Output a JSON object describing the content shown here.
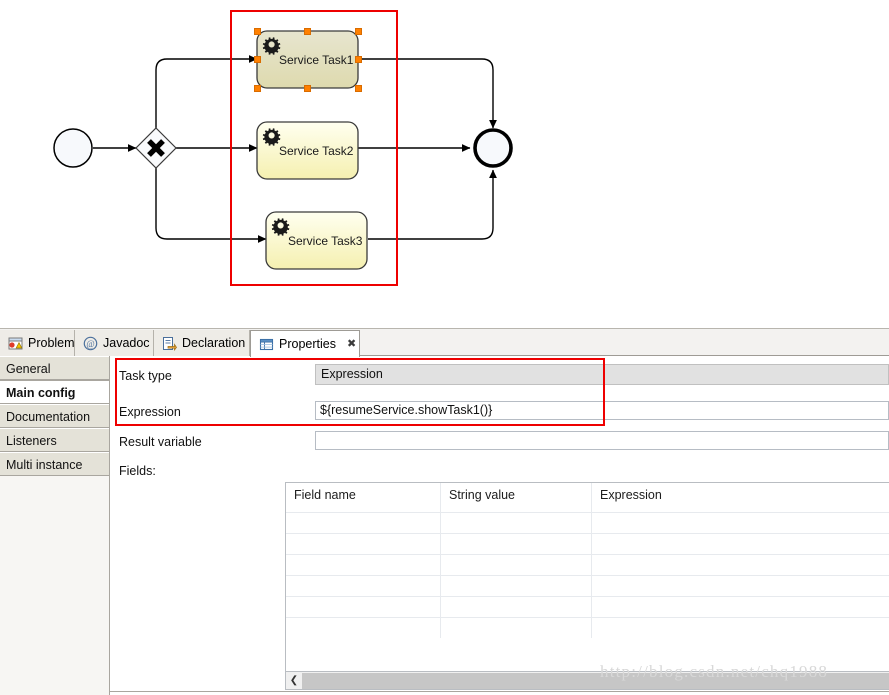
{
  "diagram": {
    "nodes": [
      {
        "id": "start-event",
        "type": "start-event",
        "label": ""
      },
      {
        "id": "gateway",
        "type": "exclusive-gateway",
        "label": ""
      },
      {
        "id": "task1",
        "type": "service-task",
        "label": "Service Task1",
        "selected": true
      },
      {
        "id": "task2",
        "type": "service-task",
        "label": "Service Task2",
        "selected": false
      },
      {
        "id": "task3",
        "type": "service-task",
        "label": "Service Task3",
        "selected": false
      },
      {
        "id": "end-event",
        "type": "end-event",
        "label": ""
      }
    ],
    "task_labels": {
      "task1": "Service Task1",
      "task2": "Service Task2",
      "task3": "Service Task3"
    },
    "highlight_color": "#ee0000",
    "selection_handle_color": "#ff8000"
  },
  "tabbar": {
    "tabs": [
      {
        "label": "Problems",
        "icon": "problems-icon",
        "active": false,
        "closable": false
      },
      {
        "label": "Javadoc",
        "icon": "javadoc-icon",
        "active": false,
        "closable": false
      },
      {
        "label": "Declaration",
        "icon": "declaration-icon",
        "active": false,
        "closable": false
      },
      {
        "label": "Properties",
        "icon": "properties-icon",
        "active": true,
        "closable": true
      }
    ],
    "close_glyph": "✖"
  },
  "sidebar": {
    "items": [
      {
        "label": "General",
        "selected": false
      },
      {
        "label": "Main config",
        "selected": true
      },
      {
        "label": "Documentation",
        "selected": false
      },
      {
        "label": "Listeners",
        "selected": false
      },
      {
        "label": "Multi instance",
        "selected": false
      }
    ]
  },
  "form": {
    "task_type": {
      "label": "Task type",
      "value": "Expression"
    },
    "expression": {
      "label": "Expression",
      "value": "${resumeService.showTask1()}"
    },
    "result_variable": {
      "label": "Result variable",
      "value": ""
    },
    "fields_label": "Fields:"
  },
  "fields_table": {
    "columns": [
      "Field name",
      "String value",
      "Expression"
    ],
    "rows": [
      [
        "",
        "",
        ""
      ],
      [
        "",
        "",
        ""
      ],
      [
        "",
        "",
        ""
      ],
      [
        "",
        "",
        ""
      ],
      [
        "",
        "",
        ""
      ],
      [
        "",
        "",
        ""
      ]
    ]
  },
  "scrollbar": {
    "left_arrow_glyph": "❮"
  },
  "watermark": {
    "text": "http://blog.csdn.net/chq1988"
  }
}
